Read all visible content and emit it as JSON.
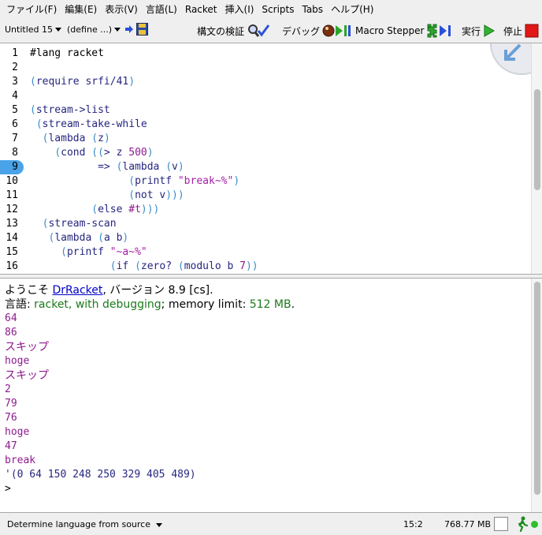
{
  "menubar": [
    "ファイル(F)",
    "編集(E)",
    "表示(V)",
    "言語(L)",
    "Racket",
    "挿入(I)",
    "Scripts",
    "Tabs",
    "ヘルプ(H)"
  ],
  "toolbar": {
    "file_menu": "Untitled 15",
    "define_menu": "(define ...)",
    "check_syntax": "構文の検証",
    "debug": "デバッグ",
    "macro_stepper": "Macro Stepper",
    "run": "実行",
    "stop": "停止"
  },
  "editor": {
    "line_numbers": [
      "1",
      "2",
      "3",
      "4",
      "5",
      "6",
      "7",
      "8",
      "9",
      "10",
      "11",
      "12",
      "13",
      "14",
      "15",
      "16"
    ],
    "breakpoint_line": "9"
  },
  "interactions": {
    "welcome_prefix": "ようこそ ",
    "welcome_link": "DrRacket",
    "welcome_suffix": ", バージョン 8.9 [cs].",
    "language_label": "言語: ",
    "language_value": "racket, with debugging",
    "memory_label": "; memory limit: ",
    "memory_value": "512 MB",
    "memory_end": ".",
    "output": [
      "64",
      "86",
      "スキップ",
      "hoge",
      "スキップ",
      "2",
      "79",
      "76",
      "hoge",
      "47",
      "break"
    ],
    "result": "'(0 64 150 248 250 329 405 489)",
    "prompt": ">"
  },
  "status": {
    "language": "Determine language from source",
    "position": "15:2",
    "memory": "768.77 MB"
  },
  "colors": {
    "keyword": "#262680",
    "paren": "#3c8cc8",
    "number": "#8e1a8e",
    "string": "#a51fa5",
    "language": "#1a7a1a",
    "breakpoint": "#4aa3e8"
  }
}
